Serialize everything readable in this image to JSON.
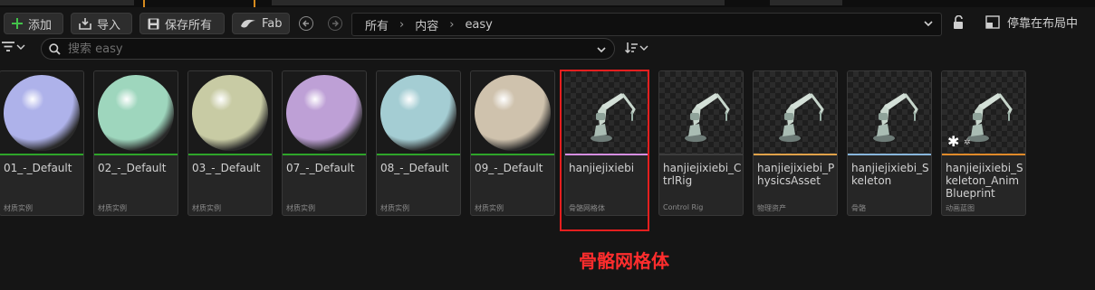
{
  "toolbar": {
    "add_label": "添加",
    "import_label": "导入",
    "save_all_label": "保存所有",
    "fab_label": "Fab"
  },
  "breadcrumb": [
    "所有",
    "内容",
    "easy"
  ],
  "dock_label": "停靠在布局中",
  "search": {
    "placeholder": "搜索 easy",
    "value": ""
  },
  "assets": [
    {
      "name": "01_-_Default",
      "type": "材质实例",
      "kind": "sphere",
      "sphere_color": "#aeb2ea",
      "stripe_color": "#2ea52a"
    },
    {
      "name": "02_-_Default",
      "type": "材质实例",
      "kind": "sphere",
      "sphere_color": "#9ed6bd",
      "stripe_color": "#2ea52a"
    },
    {
      "name": "03_-_Default",
      "type": "材质实例",
      "kind": "sphere",
      "sphere_color": "#c8cba4",
      "stripe_color": "#2ea52a"
    },
    {
      "name": "07_-_Default",
      "type": "材质实例",
      "kind": "sphere",
      "sphere_color": "#bea0d6",
      "stripe_color": "#2ea52a"
    },
    {
      "name": "08_-_Default",
      "type": "材质实例",
      "kind": "sphere",
      "sphere_color": "#a4cdd3",
      "stripe_color": "#2ea52a"
    },
    {
      "name": "09_-_Default",
      "type": "材质实例",
      "kind": "sphere",
      "sphere_color": "#cfc2ad",
      "stripe_color": "#2ea52a"
    },
    {
      "name": "hanjiejixiebi",
      "type": "骨骼网格体",
      "kind": "robot",
      "stripe_color": "#d58ee0"
    },
    {
      "name": "hanjiejixiebi_CtrlRig",
      "type": "Control Rig",
      "kind": "robot",
      "stripe_color": "#3d3d3d"
    },
    {
      "name": "hanjiejixiebi_PhysicsAsset",
      "type": "物理资产",
      "kind": "robot",
      "stripe_color": "#e0a24a"
    },
    {
      "name": "hanjiejixiebi_Skeleton",
      "type": "骨骼",
      "kind": "robot",
      "stripe_color": "#88b6dc"
    },
    {
      "name": "hanjiejixiebi_Skeleton_AnimBlueprint",
      "type": "动画蓝图",
      "kind": "robot_anim",
      "stripe_color": "#e08a2a"
    }
  ],
  "annotation": "骨骼网格体",
  "colors": {
    "highlight_border": "#e41f1f",
    "annotation_text": "#ff2d2d",
    "add_icon": "#43c24a",
    "tab_accent": "#d68a1e"
  }
}
